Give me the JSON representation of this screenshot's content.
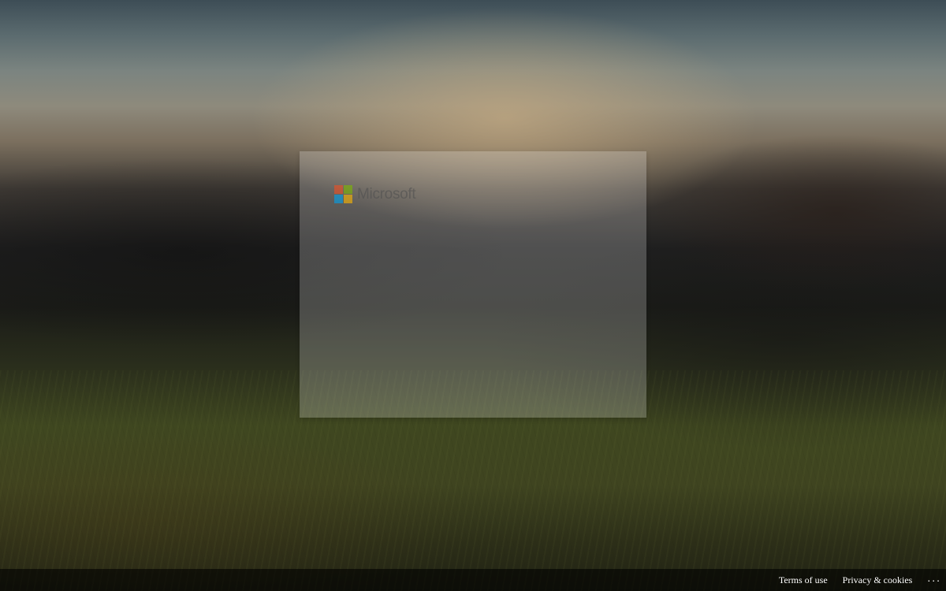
{
  "brand": {
    "name": "Microsoft",
    "logo_colors": [
      "#f25022",
      "#7fba00",
      "#00a4ef",
      "#ffb900"
    ]
  },
  "footer": {
    "links": [
      {
        "label": "Terms of use"
      },
      {
        "label": "Privacy & cookies"
      }
    ],
    "more_label": "..."
  }
}
